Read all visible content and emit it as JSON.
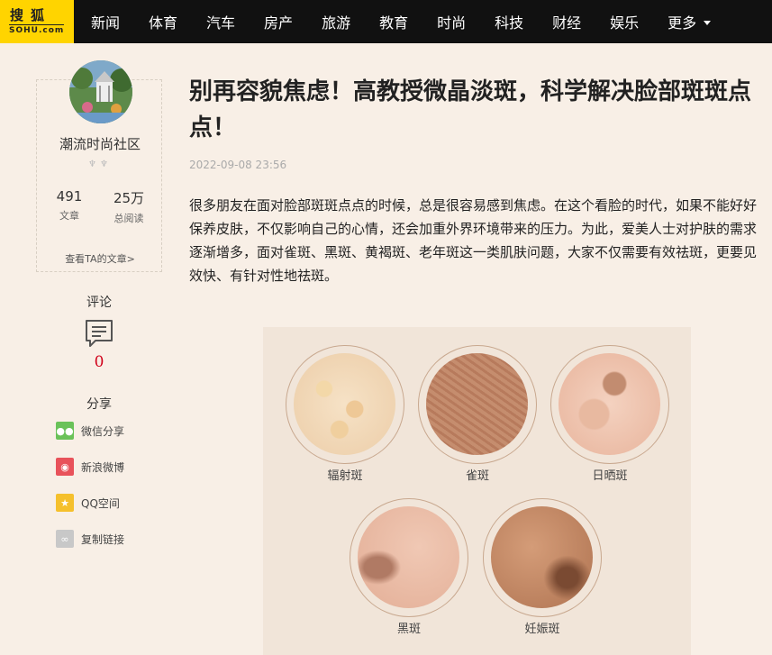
{
  "logo": {
    "cn": "搜狐",
    "en": "SOHU.com"
  },
  "nav": {
    "items": [
      "新闻",
      "体育",
      "汽车",
      "房产",
      "旅游",
      "教育",
      "时尚",
      "科技",
      "财经",
      "娱乐"
    ],
    "more": "更多"
  },
  "author": {
    "name": "潮流时尚社区",
    "articles_count": "491",
    "articles_label": "文章",
    "reads_count": "25万",
    "reads_label": "总阅读",
    "link": "查看TA的文章>"
  },
  "comment": {
    "label": "评论",
    "count": "0"
  },
  "share": {
    "label": "分享",
    "items": [
      {
        "label": "微信分享",
        "color": "#6ac259",
        "icon": "wechat-icon"
      },
      {
        "label": "新浪微博",
        "color": "#e8525a",
        "icon": "weibo-icon"
      },
      {
        "label": "QQ空间",
        "color": "#f5c02c",
        "icon": "qzone-icon"
      },
      {
        "label": "复制链接",
        "color": "#c8c8c8",
        "icon": "link-icon"
      }
    ]
  },
  "article": {
    "title": "别再容貌焦虑！高教授微晶淡斑，科学解决脸部斑斑点点！",
    "date": "2022-09-08 23:56",
    "paragraph": "很多朋友在面对脸部斑斑点点的时候，总是很容易感到焦虑。在这个看脸的时代，如果不能好好保养皮肤，不仅影响自己的心情，还会加重外界环境带来的压力。为此，爱美人士对护肤的需求逐渐增多，面对雀斑、黑斑、黄褐斑、老年斑这一类肌肤问题，大家不仅需要有效祛斑，更要见效快、有针对性地祛斑。"
  },
  "figure": {
    "labels": [
      "辐射斑",
      "雀斑",
      "日晒斑",
      "黑斑",
      "妊娠斑"
    ]
  },
  "colors": {
    "nav_bg": "#111111",
    "logo_bg": "#ffd400",
    "page_bg": "#f8efe6",
    "comment_count": "#d0021b"
  }
}
